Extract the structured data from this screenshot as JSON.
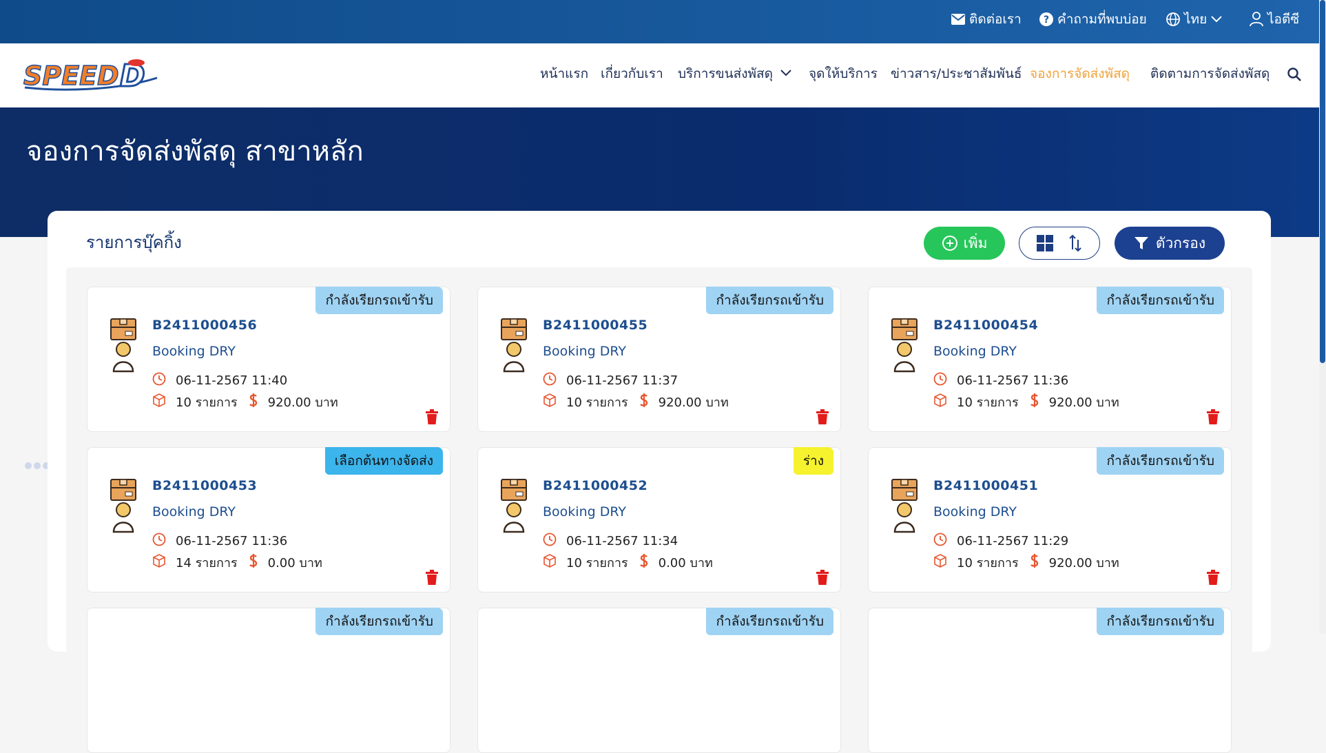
{
  "topbar": {
    "contact": "ติดต่อเรา",
    "faq": "คำถามที่พบบ่อย",
    "language": "ไทย",
    "user": "ไอตีซี"
  },
  "logo": {
    "text": "SPEED",
    "mark": "D"
  },
  "nav": {
    "items": [
      "หน้าแรก",
      "เกี่ยวกับเรา",
      "บริการขนส่งพัสดุ",
      "จุดให้บริการ",
      "ข่าวสาร/ประชาสัมพันธ์",
      "จองการจัดส่งพัสดุ",
      "ติดตามการจัดส่งพัสดุ"
    ]
  },
  "hero": {
    "title": "จองการจัดส่งพัสดุ สาขาหลัก"
  },
  "panel": {
    "title": "รายการบุ๊คกิ้ง",
    "add_label": "เพิ่ม",
    "filter_label": "ตัวกรอง"
  },
  "cards": [
    {
      "status": "กำลังเรียกรถเข้ารับ",
      "status_color": "#9fd3f3",
      "booking_no": "B2411000456",
      "type": "Booking DRY",
      "datetime": "06-11-2567 11:40",
      "items": "10 รายการ",
      "amount": "920.00 บาท"
    },
    {
      "status": "กำลังเรียกรถเข้ารับ",
      "status_color": "#9fd3f3",
      "booking_no": "B2411000455",
      "type": "Booking DRY",
      "datetime": "06-11-2567 11:37",
      "items": "10 รายการ",
      "amount": "920.00 บาท"
    },
    {
      "status": "กำลังเรียกรถเข้ารับ",
      "status_color": "#9fd3f3",
      "booking_no": "B2411000454",
      "type": "Booking DRY",
      "datetime": "06-11-2567 11:36",
      "items": "10 รายการ",
      "amount": "920.00 บาท"
    },
    {
      "status": "เลือกต้นทางจัดส่ง",
      "status_color": "#3cb4ec",
      "booking_no": "B2411000453",
      "type": "Booking DRY",
      "datetime": "06-11-2567 11:36",
      "items": "14 รายการ",
      "amount": "0.00 บาท"
    },
    {
      "status": "ร่าง",
      "status_color": "#f6f22e",
      "booking_no": "B2411000452",
      "type": "Booking DRY",
      "datetime": "06-11-2567 11:34",
      "items": "10 รายการ",
      "amount": "0.00 บาท"
    },
    {
      "status": "กำลังเรียกรถเข้ารับ",
      "status_color": "#9fd3f3",
      "booking_no": "B2411000451",
      "type": "Booking DRY",
      "datetime": "06-11-2567 11:29",
      "items": "10 รายการ",
      "amount": "920.00 บาท"
    },
    {
      "status": "กำลังเรียกรถเข้ารับ",
      "status_color": "#9fd3f3"
    },
    {
      "status": "กำลังเรียกรถเข้ารับ",
      "status_color": "#9fd3f3"
    },
    {
      "status": "กำลังเรียกรถเข้ารับ",
      "status_color": "#9fd3f3"
    }
  ]
}
